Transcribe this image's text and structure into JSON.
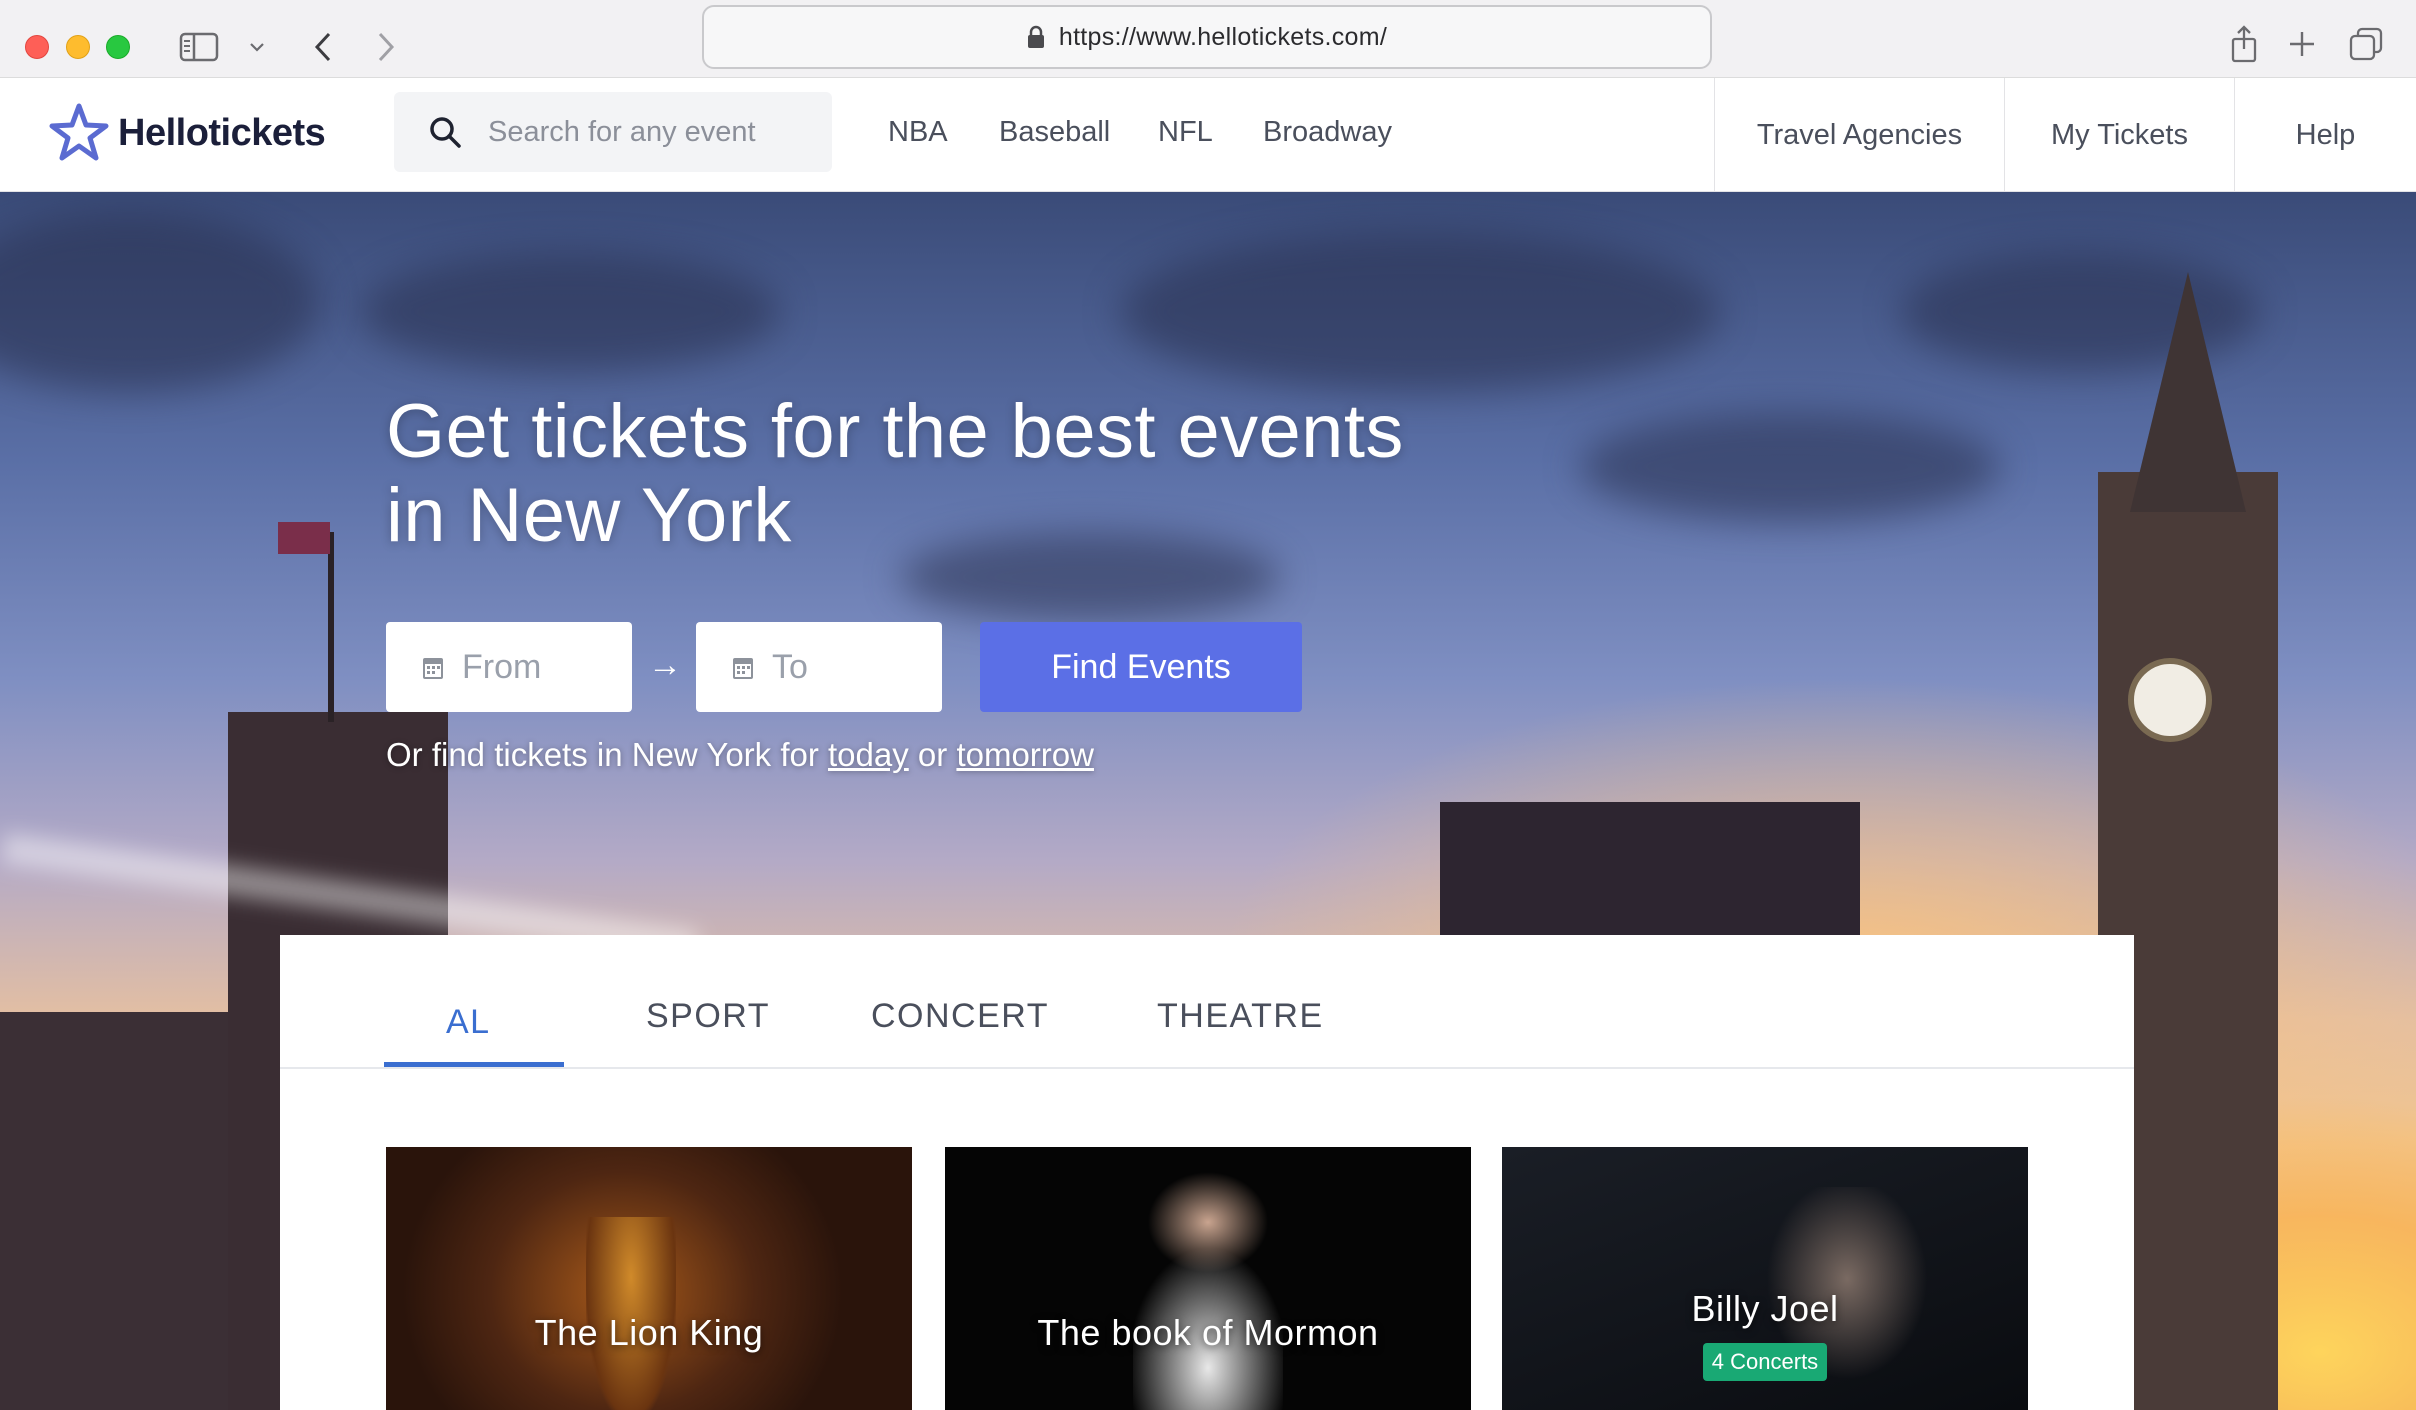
{
  "browser": {
    "url": "https://www.hellotickets.com/"
  },
  "header": {
    "logo": "Hellotickets",
    "search_placeholder": "Search for any event",
    "nav": [
      "NBA",
      "Baseball",
      "NFL",
      "Broadway"
    ],
    "right_nav": [
      "Travel Agencies",
      "My Tickets",
      "Help"
    ]
  },
  "hero": {
    "title_line1": "Get tickets for the best events",
    "title_line2": "in New York",
    "from_placeholder": "From",
    "to_placeholder": "To",
    "arrow": "→",
    "find_button": "Find Events",
    "sub_prefix": "Or find tickets in New York for",
    "sub_today": "today",
    "sub_or": "or",
    "sub_tomorrow": "tomorrow"
  },
  "tabs": [
    "AL",
    "SPORT",
    "CONCERT",
    "THEATRE"
  ],
  "cards": [
    {
      "title": "The Lion King"
    },
    {
      "title": "The book of Mormon"
    },
    {
      "title": "Billy Joel",
      "badge": "4 Concerts"
    }
  ],
  "colors": {
    "accent": "#5b6fe6",
    "tab_active": "#3a6ed0",
    "badge": "#19a974"
  }
}
